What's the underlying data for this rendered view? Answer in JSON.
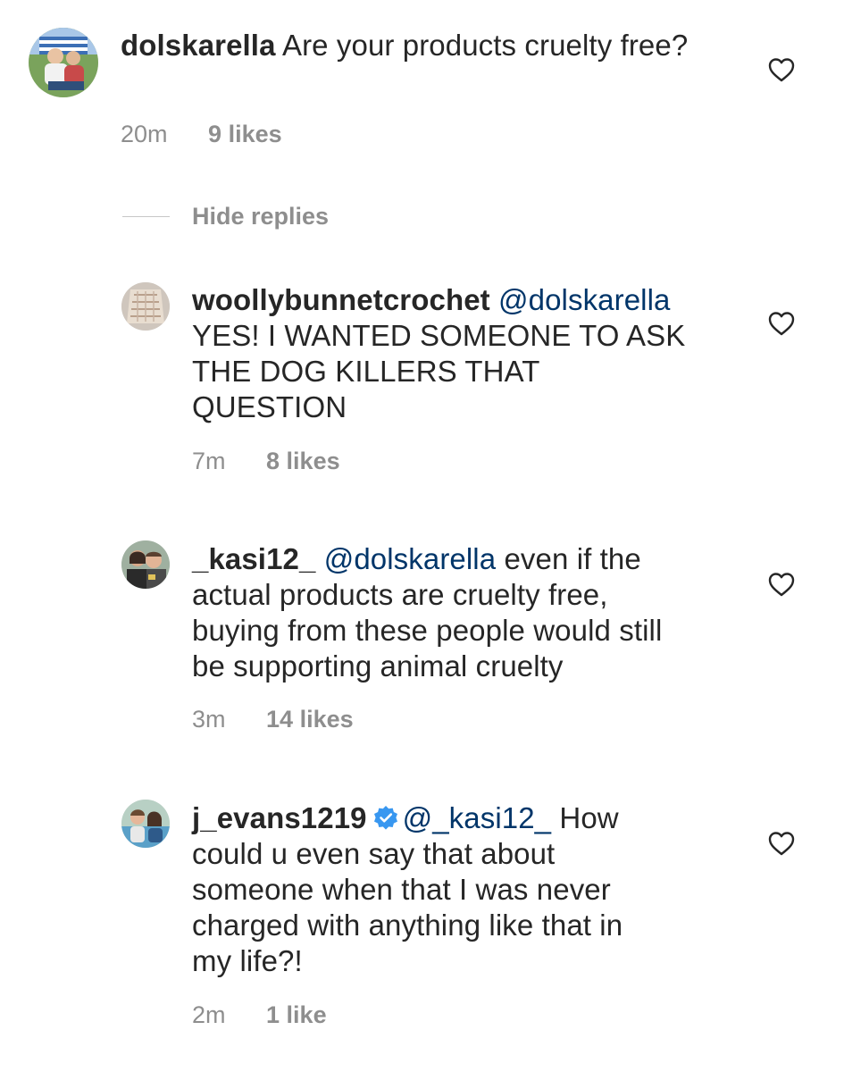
{
  "comments": [
    {
      "username": "dolskarella",
      "text": "Are your products cruelty free?",
      "time": "20m",
      "likes": "9 likes"
    },
    {
      "username": "woollybunnetcrochet",
      "mention": "@dolskarella",
      "line1": "YES! I WANTED SOMEONE TO ASK",
      "line2": "THE DOG KILLERS THAT",
      "line3": "QUESTION",
      "time": "7m",
      "likes": "8 likes"
    },
    {
      "username": "_kasi12_",
      "mention": "@dolskarella",
      "line1_rest": "even if the",
      "line2": "actual products are cruelty free,",
      "line3": "buying from these people would still",
      "line4": "be supporting animal cruelty",
      "time": "3m",
      "likes": "14 likes"
    },
    {
      "username": "j_evans1219",
      "verified": true,
      "mention": "@_kasi12_",
      "line1_rest": "How",
      "line2": "could u even say that about",
      "line3": "someone when that I was never",
      "line4": "charged with anything like that in",
      "line5": "my life?!",
      "time": "2m",
      "likes": "1 like"
    }
  ],
  "replies_toggle": "Hide replies",
  "icons": {
    "like": "heart-outline-icon",
    "verified": "verified-badge-icon"
  },
  "colors": {
    "text": "#262626",
    "meta": "#8e8e8e",
    "mention": "#003569",
    "verified": "#3897f0"
  }
}
